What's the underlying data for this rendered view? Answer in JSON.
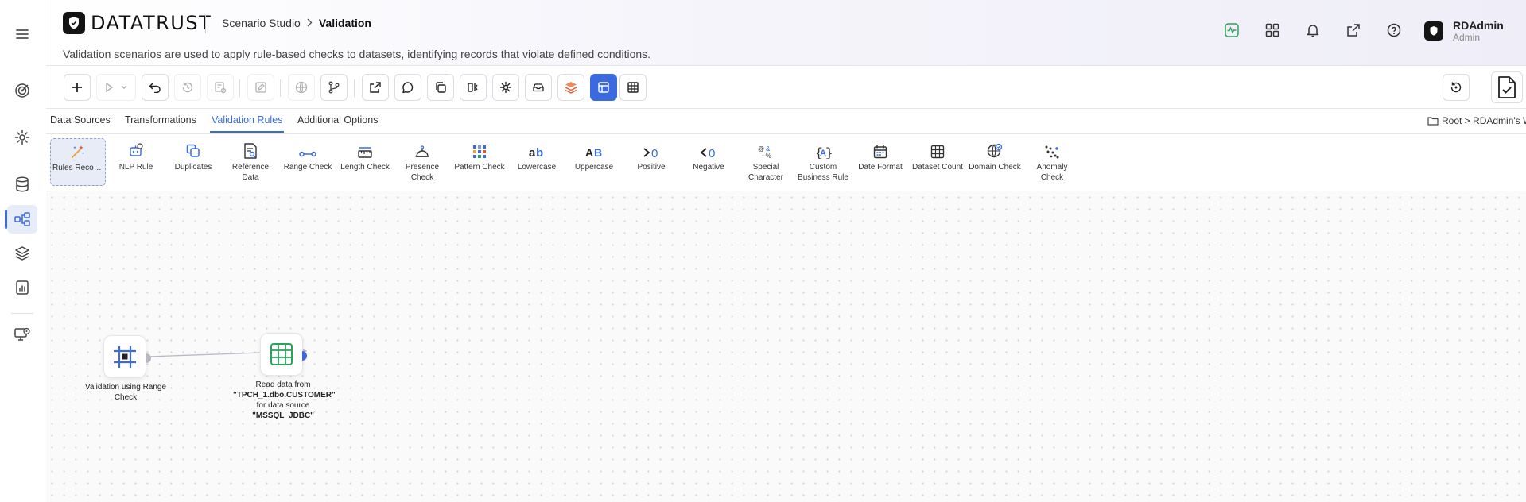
{
  "app": {
    "brand": "DATATRUST",
    "accent": "#3b6ae0"
  },
  "header": {
    "breadcrumb_parent": "Scenario Studio",
    "breadcrumb_current": "Validation",
    "subtitle": "Validation scenarios are used to apply rule-based checks to datasets, identifying records that violate defined conditions.",
    "icons": [
      "activity-icon",
      "apps-grid-icon",
      "bell-icon",
      "external-link-icon",
      "help-icon"
    ]
  },
  "user": {
    "name": "RDAdmin",
    "role": "Admin"
  },
  "sidebar": {
    "items": [
      "menu-icon",
      "target-icon",
      "settings-icon",
      "database-icon",
      "workflow-icon",
      "layers-icon",
      "report-icon",
      "monitor-icon"
    ],
    "active": "workflow-icon"
  },
  "toolbar": {
    "buttons": [
      "add",
      "run",
      "run-options",
      "undo",
      "history",
      "preview",
      "edit",
      "globe",
      "branch",
      "export",
      "comment",
      "copy",
      "split",
      "settings",
      "datasource",
      "layers",
      "layout-view",
      "table-view"
    ],
    "active": "layout-view"
  },
  "tabs": [
    {
      "label": "Data Sources"
    },
    {
      "label": "Transformations"
    },
    {
      "label": "Validation Rules",
      "active": true
    },
    {
      "label": "Additional Options"
    }
  ],
  "workspace_path": "Root > RDAdmin's Workspace",
  "palette": [
    {
      "label": "Rules Recommen...",
      "icon": "sparkle-wand-icon"
    },
    {
      "label": "NLP Rule",
      "icon": "nlp-icon"
    },
    {
      "label": "Duplicates",
      "icon": "duplicate-icon"
    },
    {
      "label": "Reference Data",
      "icon": "reference-doc-icon"
    },
    {
      "label": "Range Check",
      "icon": "range-icon"
    },
    {
      "label": "Length Check",
      "icon": "ruler-icon"
    },
    {
      "label": "Presence Check",
      "icon": "bell-presence-icon"
    },
    {
      "label": "Pattern Check",
      "icon": "pattern-grid-icon"
    },
    {
      "label": "Lowercase",
      "icon": "lowercase-ab-icon",
      "glyph": "ab"
    },
    {
      "label": "Uppercase",
      "icon": "uppercase-ab-icon",
      "glyph": "AB"
    },
    {
      "label": "Positive",
      "icon": "greater-than-zero-icon",
      "glyph": ">0"
    },
    {
      "label": "Negative",
      "icon": "less-than-zero-icon",
      "glyph": "<0"
    },
    {
      "label": "Special Character",
      "icon": "special-char-icon",
      "glyph": "@&%"
    },
    {
      "label": "Custom Business Rule",
      "icon": "curly-braces-icon",
      "glyph": "{A}"
    },
    {
      "label": "Date Format",
      "icon": "calendar-icon"
    },
    {
      "label": "Dataset Count",
      "icon": "table-count-icon"
    },
    {
      "label": "Domain Check",
      "icon": "globe-check-icon"
    },
    {
      "label": "Anomaly Check",
      "icon": "scatter-anomaly-icon"
    }
  ],
  "canvas": {
    "nodes": [
      {
        "id": "validation",
        "label": "Validation using Range Check",
        "icon": "range-validation-icon"
      },
      {
        "id": "source",
        "label_prefix": "Read data from ",
        "table": "\"TPCH_1.dbo.CUSTOMER\"",
        "label_mid": " for data source ",
        "source": "\"MSSQL_JDBC\"",
        "icon": "table-grid-icon"
      }
    ]
  }
}
